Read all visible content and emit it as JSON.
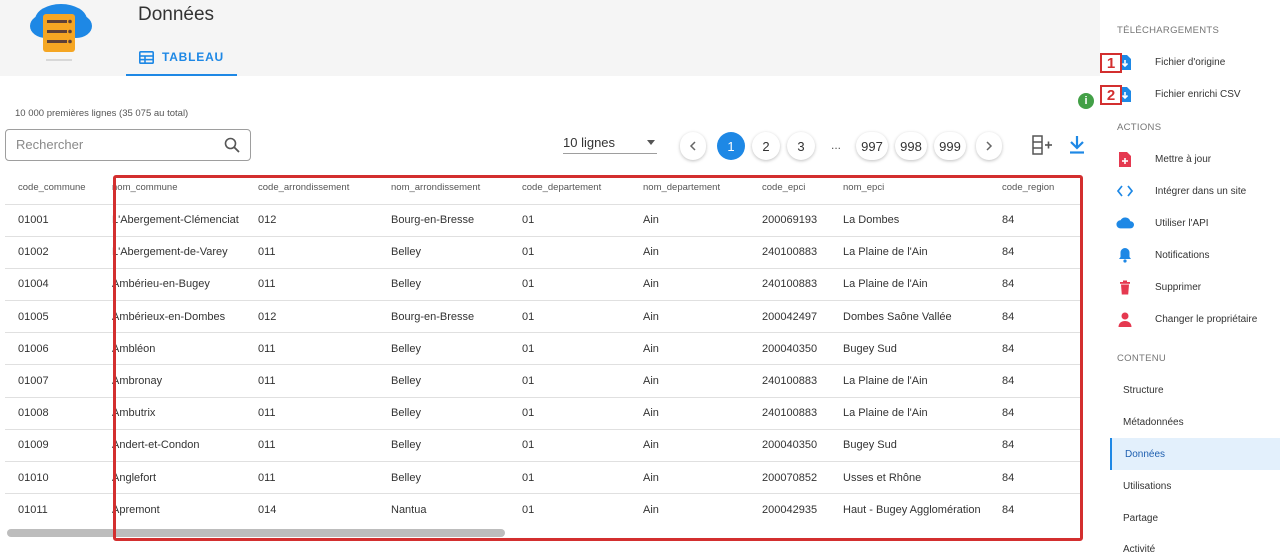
{
  "header": {
    "title": "Données",
    "tab_label": "TABLEAU"
  },
  "toolbar": {
    "row_count": "10 000 premières lignes (35 075 au total)",
    "search_placeholder": "Rechercher",
    "lines_per_page": "10 lignes",
    "pages": [
      "1",
      "2",
      "3",
      "997",
      "998",
      "999"
    ],
    "active_page": "1",
    "ellipsis": "..."
  },
  "table": {
    "columns": [
      "code_commune",
      "nom_commune",
      "code_arrondissement",
      "nom_arrondissement",
      "code_departement",
      "nom_departement",
      "code_epci",
      "nom_epci",
      "code_region"
    ],
    "rows": [
      [
        "01001",
        "L'Abergement-Clémenciat",
        "012",
        "Bourg-en-Bresse",
        "01",
        "Ain",
        "200069193",
        "La Dombes",
        "84"
      ],
      [
        "01002",
        "L'Abergement-de-Varey",
        "011",
        "Belley",
        "01",
        "Ain",
        "240100883",
        "La Plaine de l'Ain",
        "84"
      ],
      [
        "01004",
        "Ambérieu-en-Bugey",
        "011",
        "Belley",
        "01",
        "Ain",
        "240100883",
        "La Plaine de l'Ain",
        "84"
      ],
      [
        "01005",
        "Ambérieux-en-Dombes",
        "012",
        "Bourg-en-Bresse",
        "01",
        "Ain",
        "200042497",
        "Dombes Saône Vallée",
        "84"
      ],
      [
        "01006",
        "Ambléon",
        "011",
        "Belley",
        "01",
        "Ain",
        "200040350",
        "Bugey Sud",
        "84"
      ],
      [
        "01007",
        "Ambronay",
        "011",
        "Belley",
        "01",
        "Ain",
        "240100883",
        "La Plaine de l'Ain",
        "84"
      ],
      [
        "01008",
        "Ambutrix",
        "011",
        "Belley",
        "01",
        "Ain",
        "240100883",
        "La Plaine de l'Ain",
        "84"
      ],
      [
        "01009",
        "Andert-et-Condon",
        "011",
        "Belley",
        "01",
        "Ain",
        "200040350",
        "Bugey Sud",
        "84"
      ],
      [
        "01010",
        "Anglefort",
        "011",
        "Belley",
        "01",
        "Ain",
        "200070852",
        "Usses et Rhône",
        "84"
      ],
      [
        "01011",
        "Apremont",
        "014",
        "Nantua",
        "01",
        "Ain",
        "200042935",
        "Haut - Bugey Agglomération",
        "84"
      ]
    ]
  },
  "sidebar": {
    "downloads_heading": "TÉLÉCHARGEMENTS",
    "downloads": [
      "Fichier d'origine",
      "Fichier enrichi CSV"
    ],
    "actions_heading": "ACTIONS",
    "actions": [
      "Mettre à jour",
      "Intégrer dans un site",
      "Utiliser l'API",
      "Notifications",
      "Supprimer",
      "Changer le propriétaire"
    ],
    "content_heading": "CONTENU",
    "content": [
      "Structure",
      "Métadonnées",
      "Données",
      "Utilisations",
      "Partage",
      "Activité"
    ],
    "active_content": "Données"
  },
  "annotations": {
    "badge_1": "1",
    "badge_2": "2",
    "info": "i"
  },
  "colors": {
    "accent": "#1e88e5",
    "annotation": "#d32f2f",
    "danger": "#e53950",
    "info": "#43a047"
  }
}
